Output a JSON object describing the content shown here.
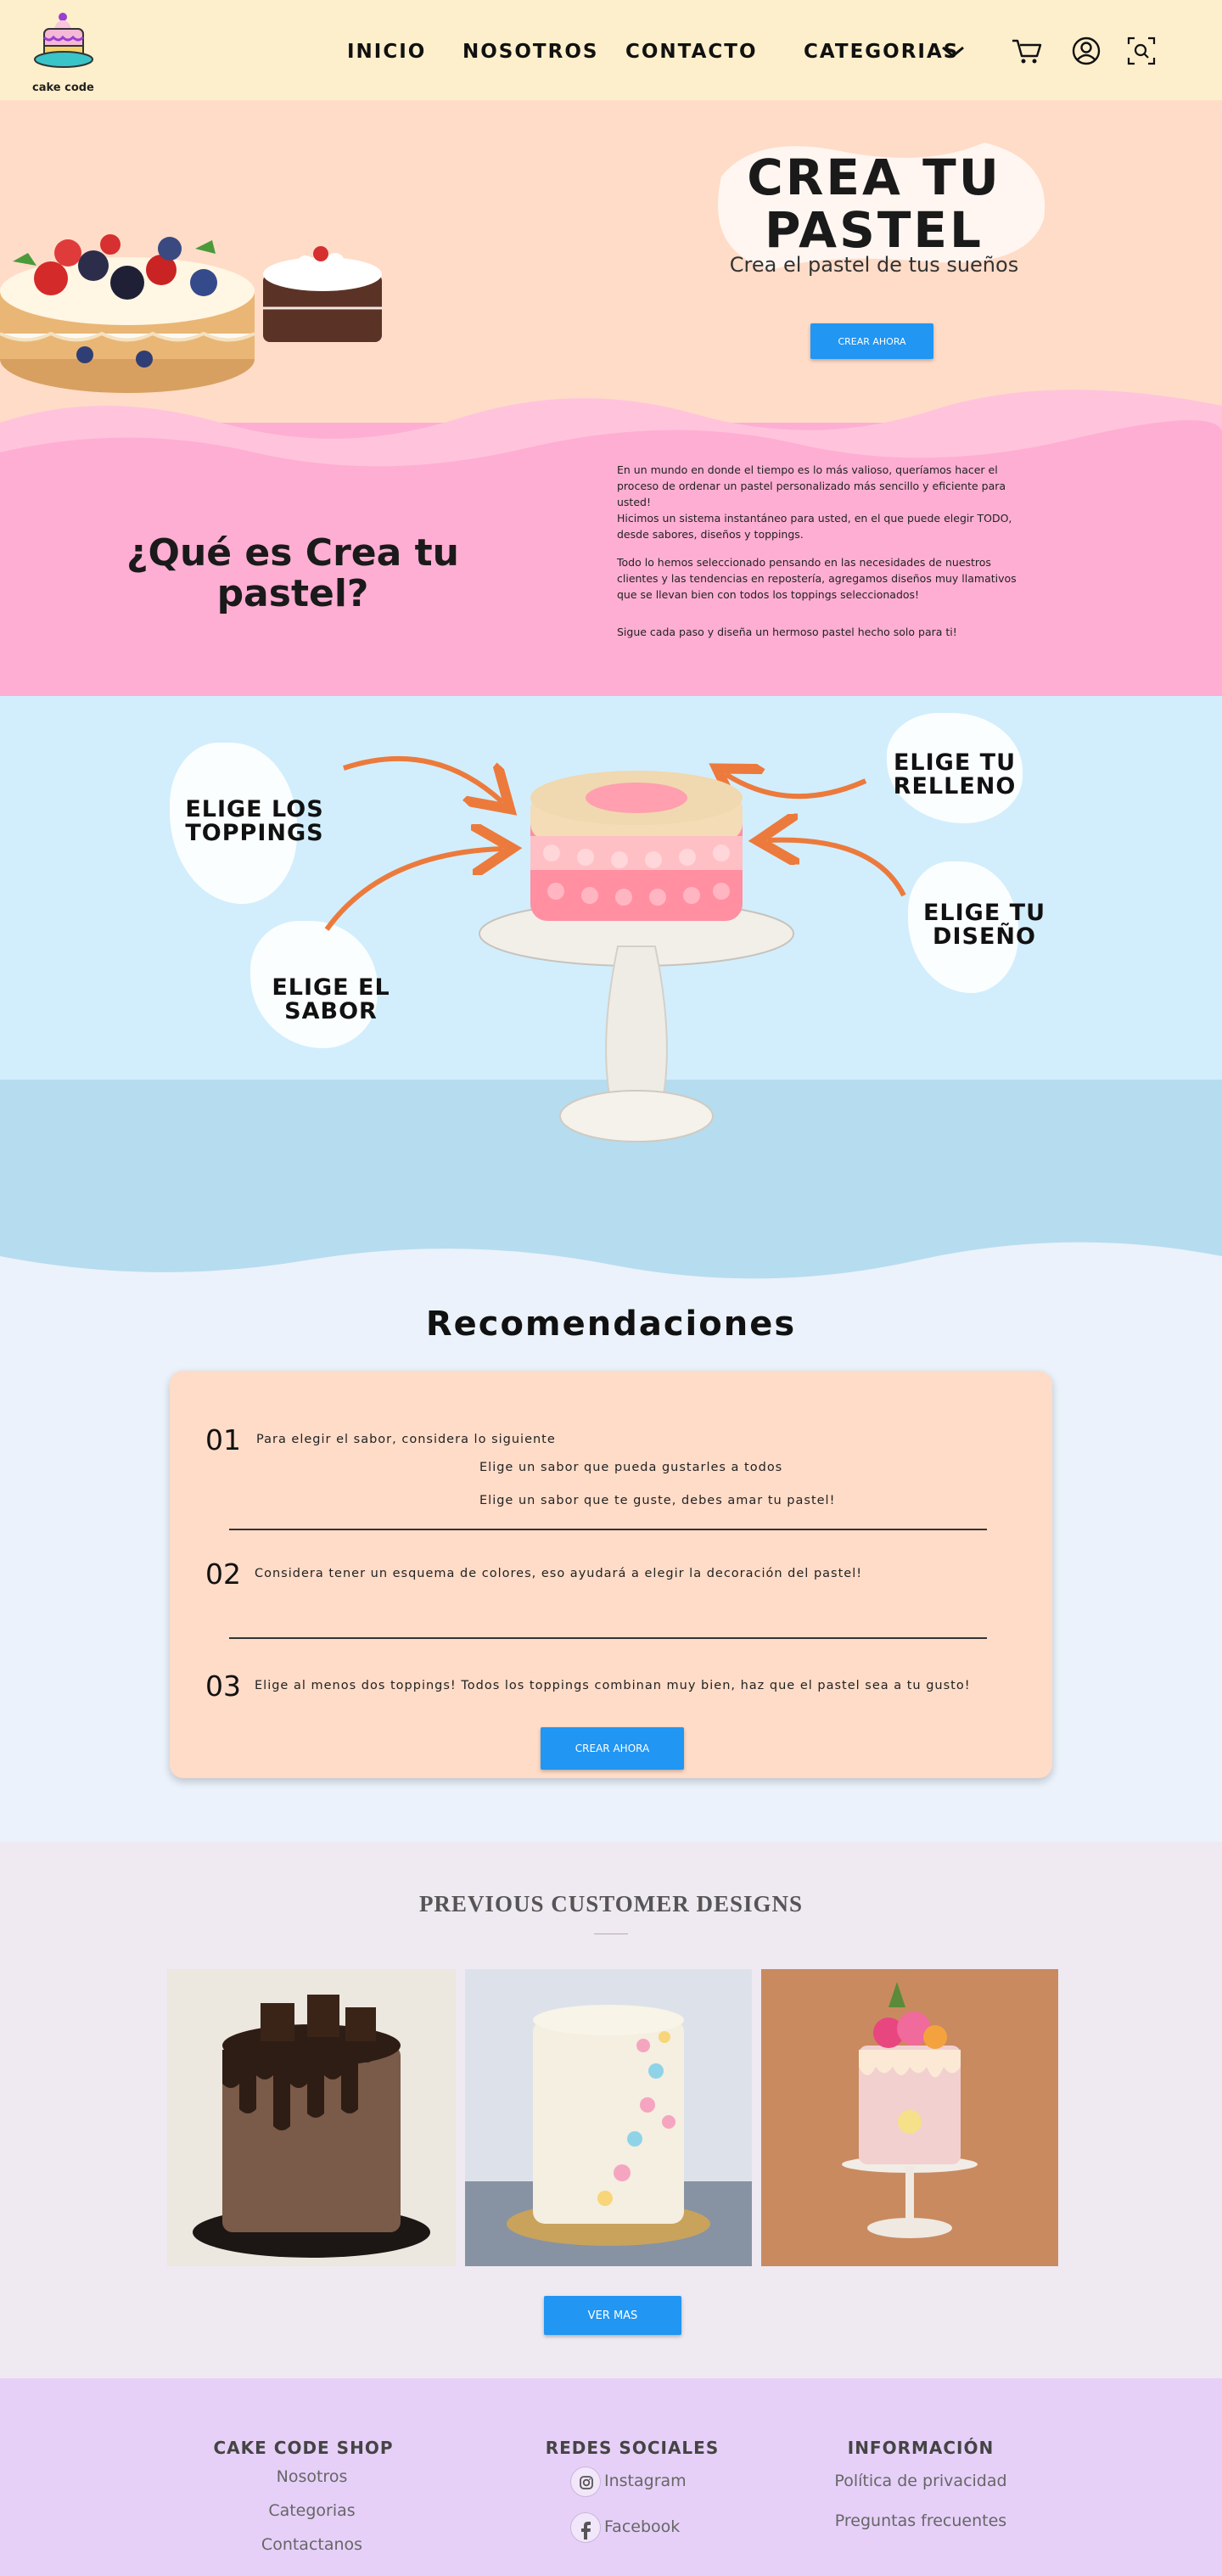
{
  "nav": {
    "logo_text": "cake code",
    "links": [
      "INICIO",
      "NOSOTROS",
      "CONTACTO",
      "CATEGORIAS"
    ]
  },
  "hero": {
    "title_line1": "CREA TU",
    "title_line2": "PASTEL",
    "subtitle": "Crea el pastel de tus sueños",
    "cta": "CREAR AHORA"
  },
  "about": {
    "title": "¿Qué es Crea tu pastel?",
    "paragraphs": [
      "En un mundo en donde el tiempo es lo más valioso, queríamos hacer el proceso de ordenar un pastel personalizado más sencillo y eficiente para usted!",
      "Hicimos un sistema instantáneo para usted, en el que puede elegir TODO, desde sabores, diseños y toppings.",
      "Todo lo hemos seleccionado pensando en las necesidades de nuestros clientes y las tendencias en repostería, agregamos diseños muy llamativos que se llevan bien con todos los toppings seleccionados!",
      "Sigue cada paso y diseña un hermoso pastel hecho solo para ti!"
    ]
  },
  "steps": {
    "toppings": "ELIGE LOS TOPPINGS",
    "relleno": "ELIGE TU RELLENO",
    "sabor": "ELIGE EL SABOR",
    "diseno": "ELIGE TU DISEÑO"
  },
  "recs": {
    "title": "Recomendaciones",
    "items": [
      {
        "num": "01",
        "text": "Para elegir el sabor, considera lo siguiente",
        "sub": [
          "Elige un sabor que pueda gustarles a todos",
          "Elige un sabor que te guste, debes amar tu pastel!"
        ]
      },
      {
        "num": "02",
        "text": "Considera tener un esquema de colores, eso ayudará a elegir la decoración del pastel!"
      },
      {
        "num": "03",
        "text": "Elige al menos dos toppings! Todos los toppings combinan muy bien, haz que el pastel sea a tu gusto!"
      }
    ],
    "cta": "CREAR AHORA"
  },
  "gallery": {
    "title": "PREVIOUS CUSTOMER DESIGNS",
    "cta": "VER MAS"
  },
  "footer": {
    "shop_title": "CAKE CODE SHOP",
    "shop_links": [
      "Nosotros",
      "Categorias",
      "Contactanos"
    ],
    "social_title": "REDES SOCIALES",
    "social_links": [
      "Instagram",
      "Facebook"
    ],
    "info_title": "INFORMACIÓN",
    "info_links": [
      "Política de privacidad",
      "Preguntas frecuentes"
    ]
  },
  "colors": {
    "nav_bg": "#fdefcb",
    "hero_peach": "#ffdcc8",
    "hero_pink": "#ffaed3",
    "sky": "#d2eefc",
    "button_blue": "#2196f3",
    "arrow_orange": "#ec7a3c",
    "footer_lilac": "#e6d0f8"
  },
  "icons": [
    "cart-icon",
    "user-icon",
    "search-icon",
    "chevron-down-icon",
    "instagram-icon",
    "facebook-icon"
  ]
}
